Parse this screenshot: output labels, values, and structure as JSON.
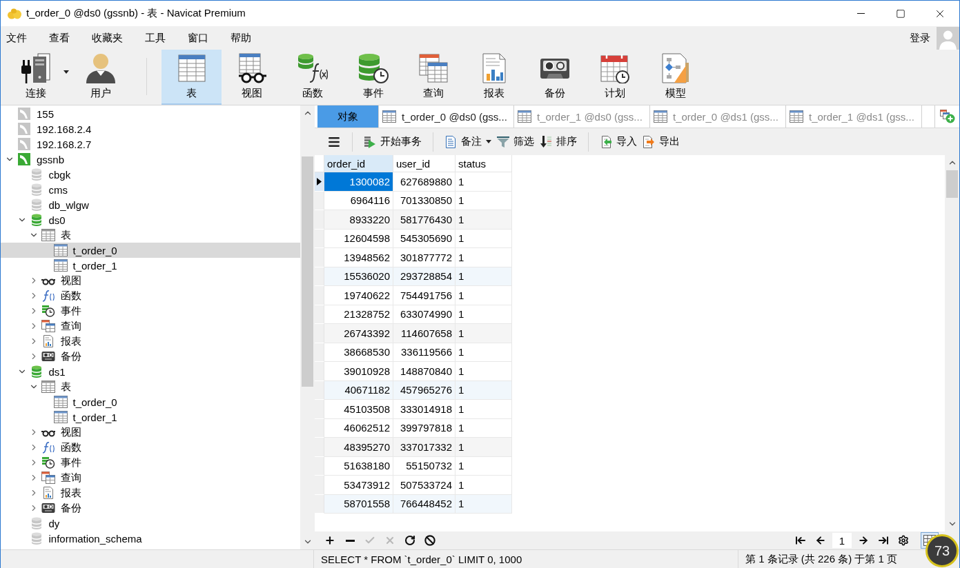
{
  "window": {
    "title": "t_order_0 @ds0 (gssnb) - 表 - Navicat Premium"
  },
  "menu": [
    "文件",
    "查看",
    "收藏夹",
    "工具",
    "窗口",
    "帮助"
  ],
  "account": {
    "login": "登录"
  },
  "toolbar": {
    "groups": [
      [
        {
          "label": "连接",
          "kind": "connection",
          "dropdown": true,
          "selected": false
        },
        {
          "label": "用户",
          "kind": "user",
          "selected": false
        }
      ],
      [
        {
          "label": "表",
          "kind": "table",
          "selected": true
        },
        {
          "label": "视图",
          "kind": "view",
          "selected": false
        },
        {
          "label": "函数",
          "kind": "function",
          "selected": false
        },
        {
          "label": "事件",
          "kind": "event",
          "selected": false
        },
        {
          "label": "查询",
          "kind": "query",
          "selected": false
        },
        {
          "label": "报表",
          "kind": "report",
          "selected": false
        },
        {
          "label": "备份",
          "kind": "backup",
          "selected": false
        },
        {
          "label": "计划",
          "kind": "schedule",
          "selected": false
        },
        {
          "label": "模型",
          "kind": "model",
          "selected": false
        }
      ]
    ]
  },
  "sidebar": {
    "tree": [
      {
        "label": "155",
        "kind": "connection",
        "open": false,
        "selected": false
      },
      {
        "label": "192.168.2.4",
        "kind": "connection",
        "open": false,
        "selected": false
      },
      {
        "label": "192.168.2.7",
        "kind": "connection",
        "open": false,
        "selected": false
      },
      {
        "label": "gssnb",
        "kind": "connection",
        "open": true,
        "expanded": true,
        "selected": false,
        "children": [
          {
            "label": "cbgk",
            "kind": "database",
            "open": false,
            "selected": false
          },
          {
            "label": "cms",
            "kind": "database",
            "open": false,
            "selected": false
          },
          {
            "label": "db_wlgw",
            "kind": "database",
            "open": false,
            "selected": false
          },
          {
            "label": "ds0",
            "kind": "database",
            "open": true,
            "expanded": true,
            "selected": false,
            "children": [
              {
                "label": "表",
                "kind": "tables",
                "expanded": true,
                "selected": false,
                "children": [
                  {
                    "label": "t_order_0",
                    "kind": "table",
                    "selected": true
                  },
                  {
                    "label": "t_order_1",
                    "kind": "table",
                    "selected": false
                  }
                ]
              },
              {
                "label": "视图",
                "kind": "views",
                "expanded": false,
                "selected": false
              },
              {
                "label": "函数",
                "kind": "functions",
                "expanded": false,
                "selected": false
              },
              {
                "label": "事件",
                "kind": "events",
                "expanded": false,
                "selected": false
              },
              {
                "label": "查询",
                "kind": "queries",
                "expanded": false,
                "selected": false
              },
              {
                "label": "报表",
                "kind": "reports",
                "expanded": false,
                "selected": false
              },
              {
                "label": "备份",
                "kind": "backups",
                "expanded": false,
                "selected": false
              }
            ]
          },
          {
            "label": "ds1",
            "kind": "database",
            "open": true,
            "expanded": true,
            "selected": false,
            "children": [
              {
                "label": "表",
                "kind": "tables",
                "expanded": true,
                "selected": false,
                "children": [
                  {
                    "label": "t_order_0",
                    "kind": "table",
                    "selected": false
                  },
                  {
                    "label": "t_order_1",
                    "kind": "table",
                    "selected": false
                  }
                ]
              },
              {
                "label": "视图",
                "kind": "views",
                "expanded": false,
                "selected": false
              },
              {
                "label": "函数",
                "kind": "functions",
                "expanded": false,
                "selected": false
              },
              {
                "label": "事件",
                "kind": "events",
                "expanded": false,
                "selected": false
              },
              {
                "label": "查询",
                "kind": "queries",
                "expanded": false,
                "selected": false
              },
              {
                "label": "报表",
                "kind": "reports",
                "expanded": false,
                "selected": false
              },
              {
                "label": "备份",
                "kind": "backups",
                "expanded": false,
                "selected": false
              }
            ]
          },
          {
            "label": "dy",
            "kind": "database",
            "open": false,
            "selected": false
          },
          {
            "label": "information_schema",
            "kind": "database",
            "open": false,
            "selected": false
          }
        ]
      }
    ]
  },
  "object_tab": {
    "label": "对象"
  },
  "tabs": [
    {
      "label": "t_order_0 @ds0 (gss...",
      "selected": true
    },
    {
      "label": "t_order_1 @ds0 (gss...",
      "selected": false
    },
    {
      "label": "t_order_0 @ds1 (gss...",
      "selected": false
    },
    {
      "label": "t_order_1 @ds1 (gss...",
      "selected": false
    }
  ],
  "grid_toolbar": {
    "groups": [
      [
        {
          "label": "开始事务",
          "kind": "transaction"
        }
      ],
      [
        {
          "label": "备注",
          "kind": "memo",
          "dropdown": true
        },
        {
          "label": "筛选",
          "kind": "filter"
        },
        {
          "label": "排序",
          "kind": "sort"
        }
      ],
      [
        {
          "label": "导入",
          "kind": "import"
        },
        {
          "label": "导出",
          "kind": "export"
        }
      ]
    ]
  },
  "table": {
    "columns": [
      {
        "label": "order_id",
        "kind": "number",
        "selected": true
      },
      {
        "label": "user_id",
        "kind": "number",
        "selected": false
      },
      {
        "label": "status",
        "kind": "plain",
        "selected": false
      }
    ],
    "rows": [
      {
        "cells": [
          "1300082",
          "627689880",
          "1"
        ],
        "selected": true
      },
      {
        "cells": [
          "6964116",
          "701330850",
          "1"
        ],
        "selected": false
      },
      {
        "cells": [
          "8933220",
          "581776430",
          "1"
        ],
        "selected": false
      },
      {
        "cells": [
          "12604598",
          "545305690",
          "1"
        ],
        "selected": false
      },
      {
        "cells": [
          "13948562",
          "301877772",
          "1"
        ],
        "selected": false
      },
      {
        "cells": [
          "15536020",
          "293728854",
          "1"
        ],
        "selected": false
      },
      {
        "cells": [
          "19740622",
          "754491756",
          "1"
        ],
        "selected": false
      },
      {
        "cells": [
          "21328752",
          "633074990",
          "1"
        ],
        "selected": false
      },
      {
        "cells": [
          "26743392",
          "114607658",
          "1"
        ],
        "selected": false
      },
      {
        "cells": [
          "38668530",
          "336119566",
          "1"
        ],
        "selected": false
      },
      {
        "cells": [
          "39010928",
          "148870840",
          "1"
        ],
        "selected": false
      },
      {
        "cells": [
          "40671182",
          "457965276",
          "1"
        ],
        "selected": false
      },
      {
        "cells": [
          "45103508",
          "333014918",
          "1"
        ],
        "selected": false
      },
      {
        "cells": [
          "46062512",
          "399797818",
          "1"
        ],
        "selected": false
      },
      {
        "cells": [
          "48395270",
          "337017332",
          "1"
        ],
        "selected": false
      },
      {
        "cells": [
          "51638180",
          "55150732",
          "1"
        ],
        "selected": false
      },
      {
        "cells": [
          "53473912",
          "507533724",
          "1"
        ],
        "selected": false
      },
      {
        "cells": [
          "58701558",
          "766448452",
          "1"
        ],
        "selected": false
      }
    ]
  },
  "edit_buttons": [
    {
      "kind": "add",
      "disabled": false
    },
    {
      "kind": "delete",
      "disabled": false
    },
    {
      "kind": "apply",
      "disabled": true
    },
    {
      "kind": "discard",
      "disabled": true
    },
    {
      "kind": "refresh",
      "disabled": false
    },
    {
      "kind": "stop",
      "disabled": false
    }
  ],
  "pager": {
    "page": "1",
    "grid_view": {
      "selected": true
    }
  },
  "status_bar": {
    "query": "SELECT * FROM `t_order_0` LIMIT 0, 1000",
    "records": "第 1 条记录 (共 226 条) 于第 1 页"
  },
  "speed_ball": {
    "text": "73"
  }
}
